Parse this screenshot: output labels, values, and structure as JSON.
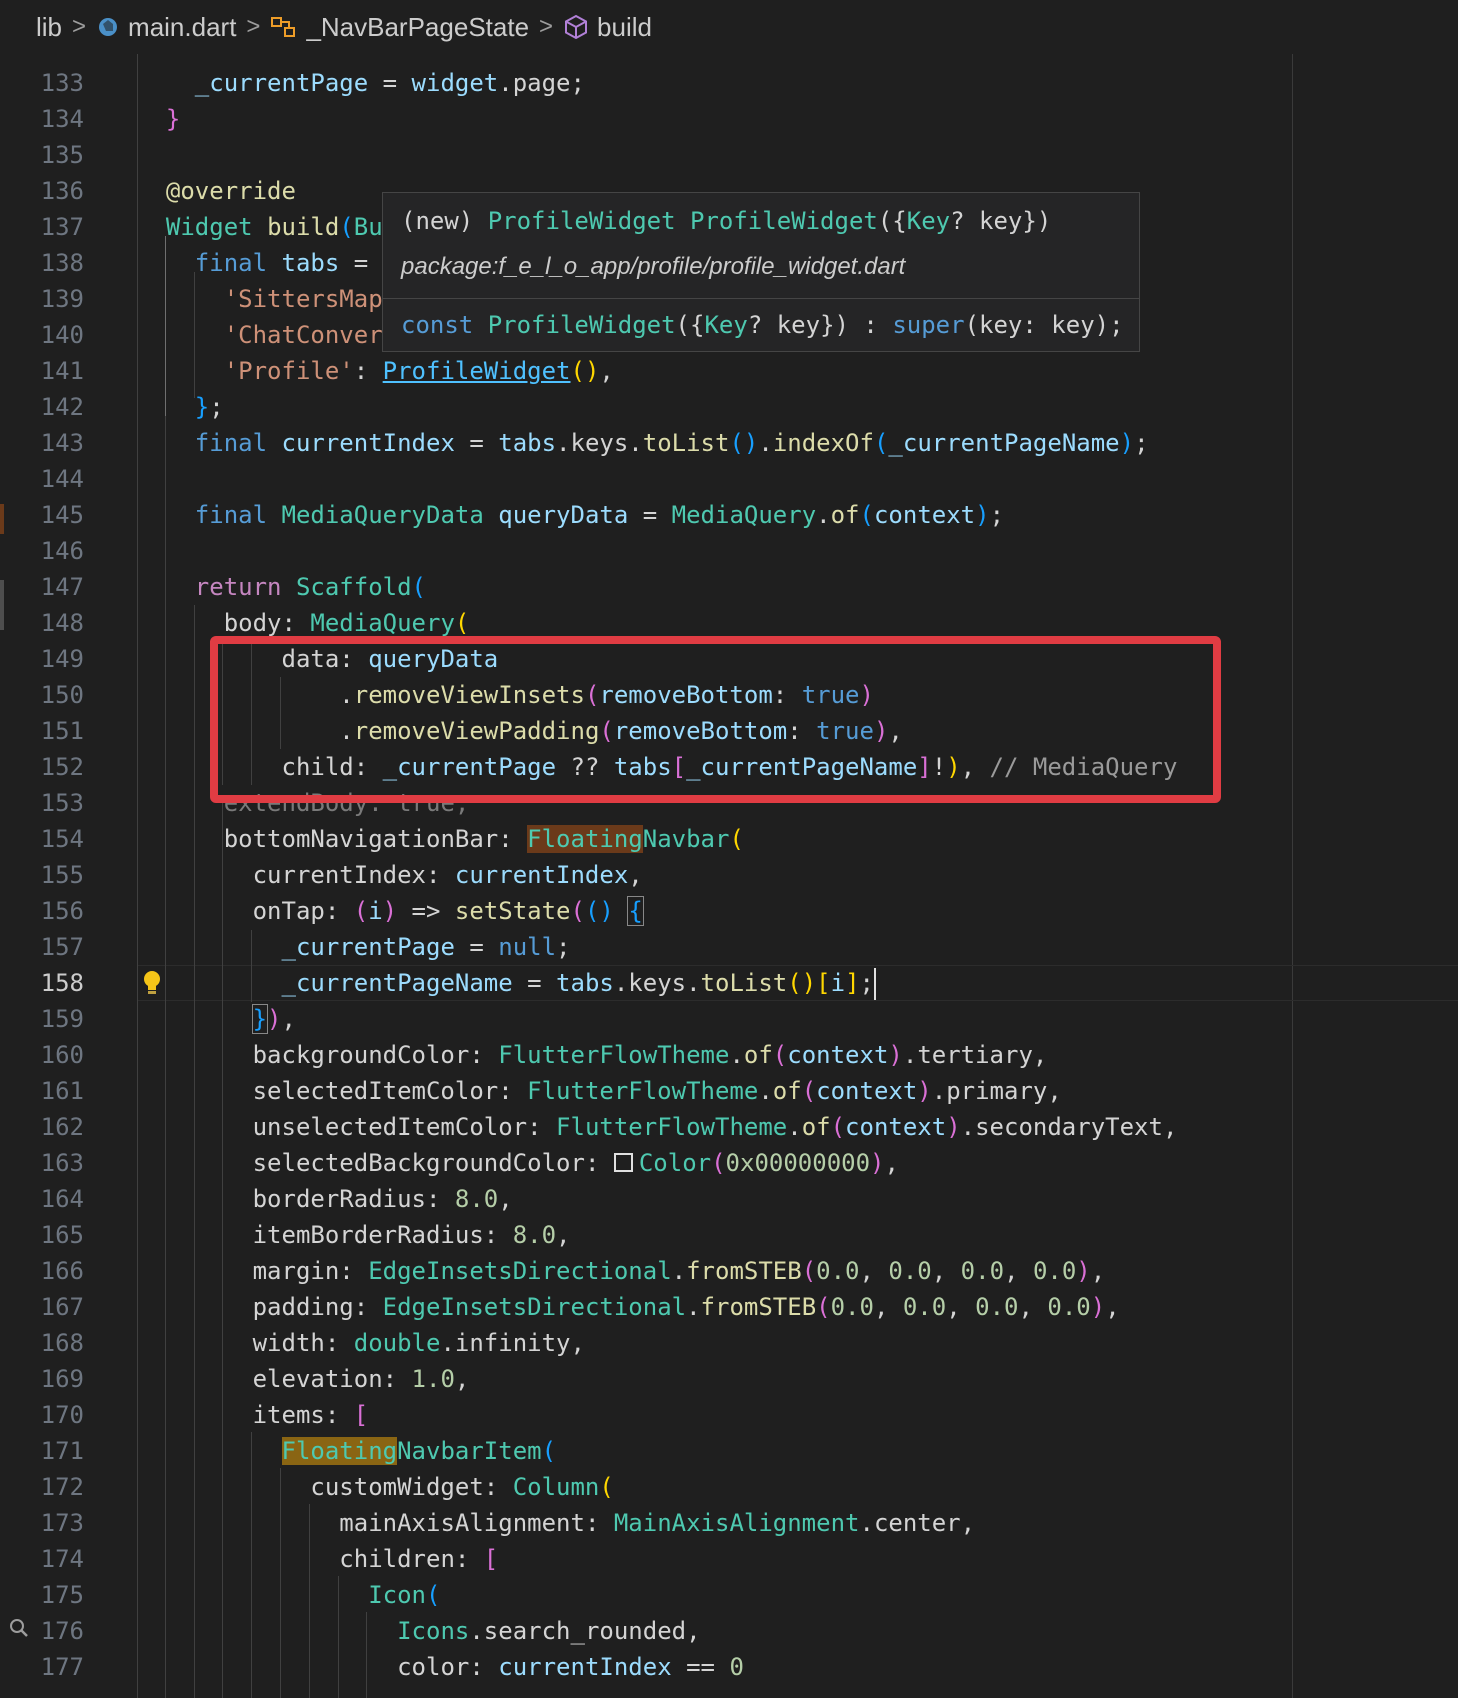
{
  "breadcrumb": {
    "items": [
      "lib",
      "main.dart",
      "_NavBarPageState",
      "build"
    ]
  },
  "editor": {
    "line_numbers": [
      "133",
      "134",
      "135",
      "136",
      "137",
      "138",
      "139",
      "140",
      "141",
      "142",
      "143",
      "144",
      "145",
      "146",
      "147",
      "148",
      "149",
      "150",
      "151",
      "152",
      "153",
      "154",
      "155",
      "156",
      "157",
      "158",
      "159",
      "160",
      "161",
      "162",
      "163",
      "164",
      "165",
      "166",
      "167",
      "168",
      "169",
      "170",
      "171",
      "172",
      "173",
      "174",
      "175",
      "176",
      "177"
    ],
    "active_line": "158",
    "code": {
      "l133_page": "_currentPage",
      "l133_widget": "widget",
      "l133_prop": "page",
      "l136_override": "@override",
      "l137_type": "Widget",
      "l137_fn": "build",
      "l137_rest": "Bu",
      "l138_final": "final",
      "l138_tabs": "tabs",
      "l139_str": "'SittersMap",
      "l140_str": "'ChatConver",
      "l141_str": "'Profile'",
      "l141_widget": "ProfileWidget",
      "l143_final": "final",
      "l143_var": "currentIndex",
      "l143_tabs": "tabs",
      "l143_keys": "keys",
      "l143_tolist": "toList",
      "l143_indexof": "indexOf",
      "l143_arg": "_currentPageName",
      "l145_final": "final",
      "l145_type": "MediaQueryData",
      "l145_var": "queryData",
      "l145_class": "MediaQuery",
      "l145_of": "of",
      "l145_ctx": "context",
      "l147_return": "return",
      "l147_class": "Scaffold",
      "l148_prop": "body",
      "l148_class": "MediaQuery",
      "l149_prop": "data",
      "l149_val": "queryData",
      "l150_fn": "removeViewInsets",
      "l150_param": "removeBottom",
      "l150_val": "true",
      "l151_fn": "removeViewPadding",
      "l151_param": "removeBottom",
      "l151_val": "true",
      "l152_prop": "child",
      "l152_page": "_currentPage",
      "l152_tabs": "tabs",
      "l152_name": "_currentPageName",
      "l152_comment": "// MediaQuery",
      "l153_hidden": "extendBody: true,",
      "l154_prop": "bottomNavigationBar",
      "l154_hl": "Floating",
      "l154_rest": "Navbar",
      "l155_prop": "currentIndex",
      "l155_val": "currentIndex",
      "l156_prop": "onTap",
      "l156_i": "i",
      "l156_fn": "setState",
      "l157_var": "_currentPage",
      "l157_null": "null",
      "l158_var": "_currentPageName",
      "l158_tabs": "tabs",
      "l158_keys": "keys",
      "l158_tolist": "toList",
      "l158_i": "i",
      "l160_prop": "backgroundColor",
      "l160_theme": "FlutterFlowTheme",
      "l160_of": "of",
      "l160_ctx": "context",
      "l160_val": "tertiary",
      "l161_prop": "selectedItemColor",
      "l161_val": "primary",
      "l162_prop": "unselectedItemColor",
      "l162_val": "secondaryText",
      "l163_prop": "selectedBackgroundColor",
      "l163_class": "Color",
      "l163_num": "0x00000000",
      "l164_prop": "borderRadius",
      "l164_num": "8.0",
      "l165_prop": "itemBorderRadius",
      "l165_num": "8.0",
      "l166_prop": "margin",
      "l166_class": "EdgeInsetsDirectional",
      "l166_fn": "fromSTEB",
      "l167_prop": "padding",
      "num_zero": "0.0",
      "l168_prop": "width",
      "l168_type": "double",
      "l168_val": "infinity",
      "l169_prop": "elevation",
      "l169_num": "1.0",
      "l170_prop": "items",
      "l171_hl": "Floating",
      "l171_rest": "NavbarItem",
      "l172_prop": "customWidget",
      "l172_class": "Column",
      "l173_prop": "mainAxisAlignment",
      "l173_class": "MainAxisAlignment",
      "l173_val": "center",
      "l174_prop": "children",
      "l175_class": "Icon",
      "l176_class": "Icons",
      "l176_val": "search_rounded",
      "l177_prop": "color",
      "l177_var": "currentIndex",
      "l177_num": "0"
    }
  },
  "hover": {
    "sig_new": "(new)",
    "sig_class": "ProfileWidget",
    "sig_ctor": "ProfileWidget",
    "sig_key_type": "Key",
    "sig_key": "key",
    "package": "package:f_e_l_o_app/profile/profile_widget.dart",
    "decl_const": "const",
    "decl_class": "ProfileWidget",
    "decl_key_type": "Key",
    "decl_key": "key",
    "decl_super": "super",
    "decl_param": "key",
    "decl_arg": "key"
  },
  "colors": {
    "highlight_border": "#e03c43",
    "background": "#1f1f1f"
  }
}
